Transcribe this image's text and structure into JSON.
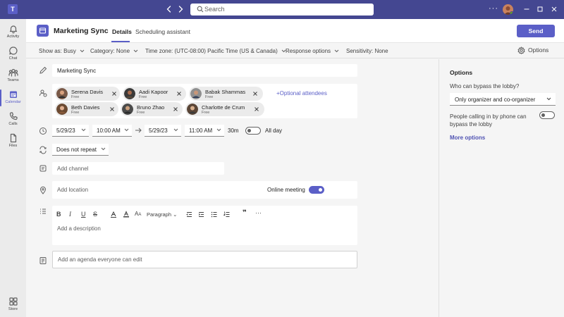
{
  "titlebar": {
    "search_placeholder": "Search",
    "more": "···"
  },
  "rail": {
    "items": [
      {
        "label": "Activity",
        "icon": "bell-icon"
      },
      {
        "label": "Chat",
        "icon": "chat-icon"
      },
      {
        "label": "Teams",
        "icon": "teams-icon"
      },
      {
        "label": "Calendar",
        "icon": "calendar-icon",
        "active": true
      },
      {
        "label": "Calls",
        "icon": "phone-icon"
      },
      {
        "label": "Files",
        "icon": "file-icon"
      }
    ],
    "store_label": "Store"
  },
  "header": {
    "title": "Marketing Sync",
    "tabs": [
      {
        "label": "Details",
        "active": true
      },
      {
        "label": "Scheduling assistant"
      }
    ],
    "send_label": "Send"
  },
  "toolbar": {
    "show_as": "Show as: Busy",
    "category": "Category: None",
    "time_zone": "Time zone: (UTC-08:00) Pacific Time (US & Canada)",
    "response_options": "Response options",
    "sensitivity": "Sensitivity: None",
    "options_label": "Options"
  },
  "form": {
    "title_value": "Marketing Sync",
    "attendees": [
      {
        "name": "Serena Davis",
        "status": "Free"
      },
      {
        "name": "Aadi Kapoor",
        "status": "Free"
      },
      {
        "name": "Babak Shammas",
        "status": "Free"
      },
      {
        "name": "Beth Davies",
        "status": "Free"
      },
      {
        "name": "Bruno Zhao",
        "status": "Free"
      },
      {
        "name": "Charlotte de Crum",
        "status": "Free"
      }
    ],
    "optional_attendees": "+Optional attendees",
    "start_date": "5/29/23",
    "start_time": "10:00 AM",
    "end_date": "5/29/23",
    "end_time": "11:00 AM",
    "duration": "30m",
    "all_day_label": "All day",
    "repeat": "Does not repeat",
    "channel_placeholder": "Add channel",
    "location_placeholder": "Add location",
    "online_meeting_label": "Online meeting",
    "paragraph_label": "Paragraph",
    "description_placeholder": "Add a description",
    "agenda_placeholder": "Add an agenda everyone can edit"
  },
  "options_panel": {
    "title": "Options",
    "lobby_question": "Who can bypass the lobby?",
    "lobby_value": "Only organizer and co-organizer",
    "phone_bypass": "People calling in by  phone can bypass the lobby",
    "more_options": "More options"
  },
  "colors": {
    "brand": "#5b5fc7",
    "titlebar": "#444791"
  }
}
